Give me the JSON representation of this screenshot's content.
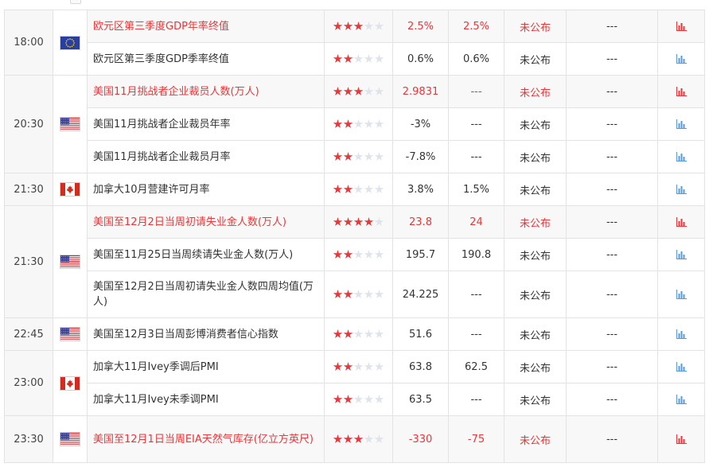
{
  "colors": {
    "important": "#e4393c",
    "normal_text": "#333333",
    "star_on": "#e4393c",
    "star_off": "#dfe3ea",
    "chart_icon_important": "#e4393c",
    "chart_icon_normal": "#5b9bd5",
    "border": "#e3e3e3"
  },
  "groups": [
    {
      "time": "18:00",
      "flag": "eu-flag-icon",
      "rows": [
        {
          "event": "欧元区第三季度GDP年率终值",
          "stars": 3,
          "actual": "2.5%",
          "forecast": "2.5%",
          "status": "未公布",
          "extra": "---",
          "important": true
        },
        {
          "event": "欧元区第三季度GDP季率终值",
          "stars": 2,
          "actual": "0.6%",
          "forecast": "0.6%",
          "status": "未公布",
          "extra": "---",
          "important": false
        }
      ]
    },
    {
      "time": "20:30",
      "flag": "us-flag-icon",
      "rows": [
        {
          "event": "美国11月挑战者企业裁员人数(万人)",
          "stars": 3,
          "actual": "2.9831",
          "forecast": "---",
          "status": "未公布",
          "extra": "---",
          "important": true
        },
        {
          "event": "美国11月挑战者企业裁员年率",
          "stars": 2,
          "actual": "-3%",
          "forecast": "---",
          "status": "未公布",
          "extra": "---",
          "important": false
        },
        {
          "event": "美国11月挑战者企业裁员月率",
          "stars": 2,
          "actual": "-7.8%",
          "forecast": "---",
          "status": "未公布",
          "extra": "---",
          "important": false
        }
      ]
    },
    {
      "time": "21:30",
      "flag": "ca-flag-icon",
      "rows": [
        {
          "event": "加拿大10月营建许可月率",
          "stars": 2,
          "actual": "3.8%",
          "forecast": "1.5%",
          "status": "未公布",
          "extra": "---",
          "important": false
        }
      ]
    },
    {
      "time": "21:30",
      "flag": "us-flag-icon",
      "rows": [
        {
          "event": "美国至12月2日当周初请失业金人数(万人)",
          "stars": 4,
          "actual": "23.8",
          "forecast": "24",
          "status": "未公布",
          "extra": "---",
          "important": true
        },
        {
          "event": "美国至11月25日当周续请失业金人数(万人)",
          "stars": 2,
          "actual": "195.7",
          "forecast": "190.8",
          "status": "未公布",
          "extra": "---",
          "important": false
        },
        {
          "event": "美国至12月2日当周初请失业金人数四周均值(万人)",
          "stars": 2,
          "actual": "24.225",
          "forecast": "---",
          "status": "未公布",
          "extra": "---",
          "important": false,
          "tall": true
        }
      ]
    },
    {
      "time": "22:45",
      "flag": "us-flag-icon",
      "rows": [
        {
          "event": "美国至12月3日当周彭博消费者信心指数",
          "stars": 2,
          "actual": "51.6",
          "forecast": "---",
          "status": "未公布",
          "extra": "---",
          "important": false
        }
      ]
    },
    {
      "time": "23:00",
      "flag": "ca-flag-icon",
      "rows": [
        {
          "event": "加拿大11月Ivey季调后PMI",
          "stars": 2,
          "actual": "63.8",
          "forecast": "62.5",
          "status": "未公布",
          "extra": "---",
          "important": false
        },
        {
          "event": "加拿大11月Ivey未季调PMI",
          "stars": 2,
          "actual": "63.5",
          "forecast": "---",
          "status": "未公布",
          "extra": "---",
          "important": false
        }
      ]
    },
    {
      "time": "23:30",
      "flag": "us-flag-icon",
      "rows": [
        {
          "event": "美国至12月1日当周EIA天然气库存(亿立方英尺)",
          "stars": 3,
          "actual": "-330",
          "forecast": "-75",
          "status": "未公布",
          "extra": "---",
          "important": true,
          "tall": true
        }
      ]
    }
  ]
}
